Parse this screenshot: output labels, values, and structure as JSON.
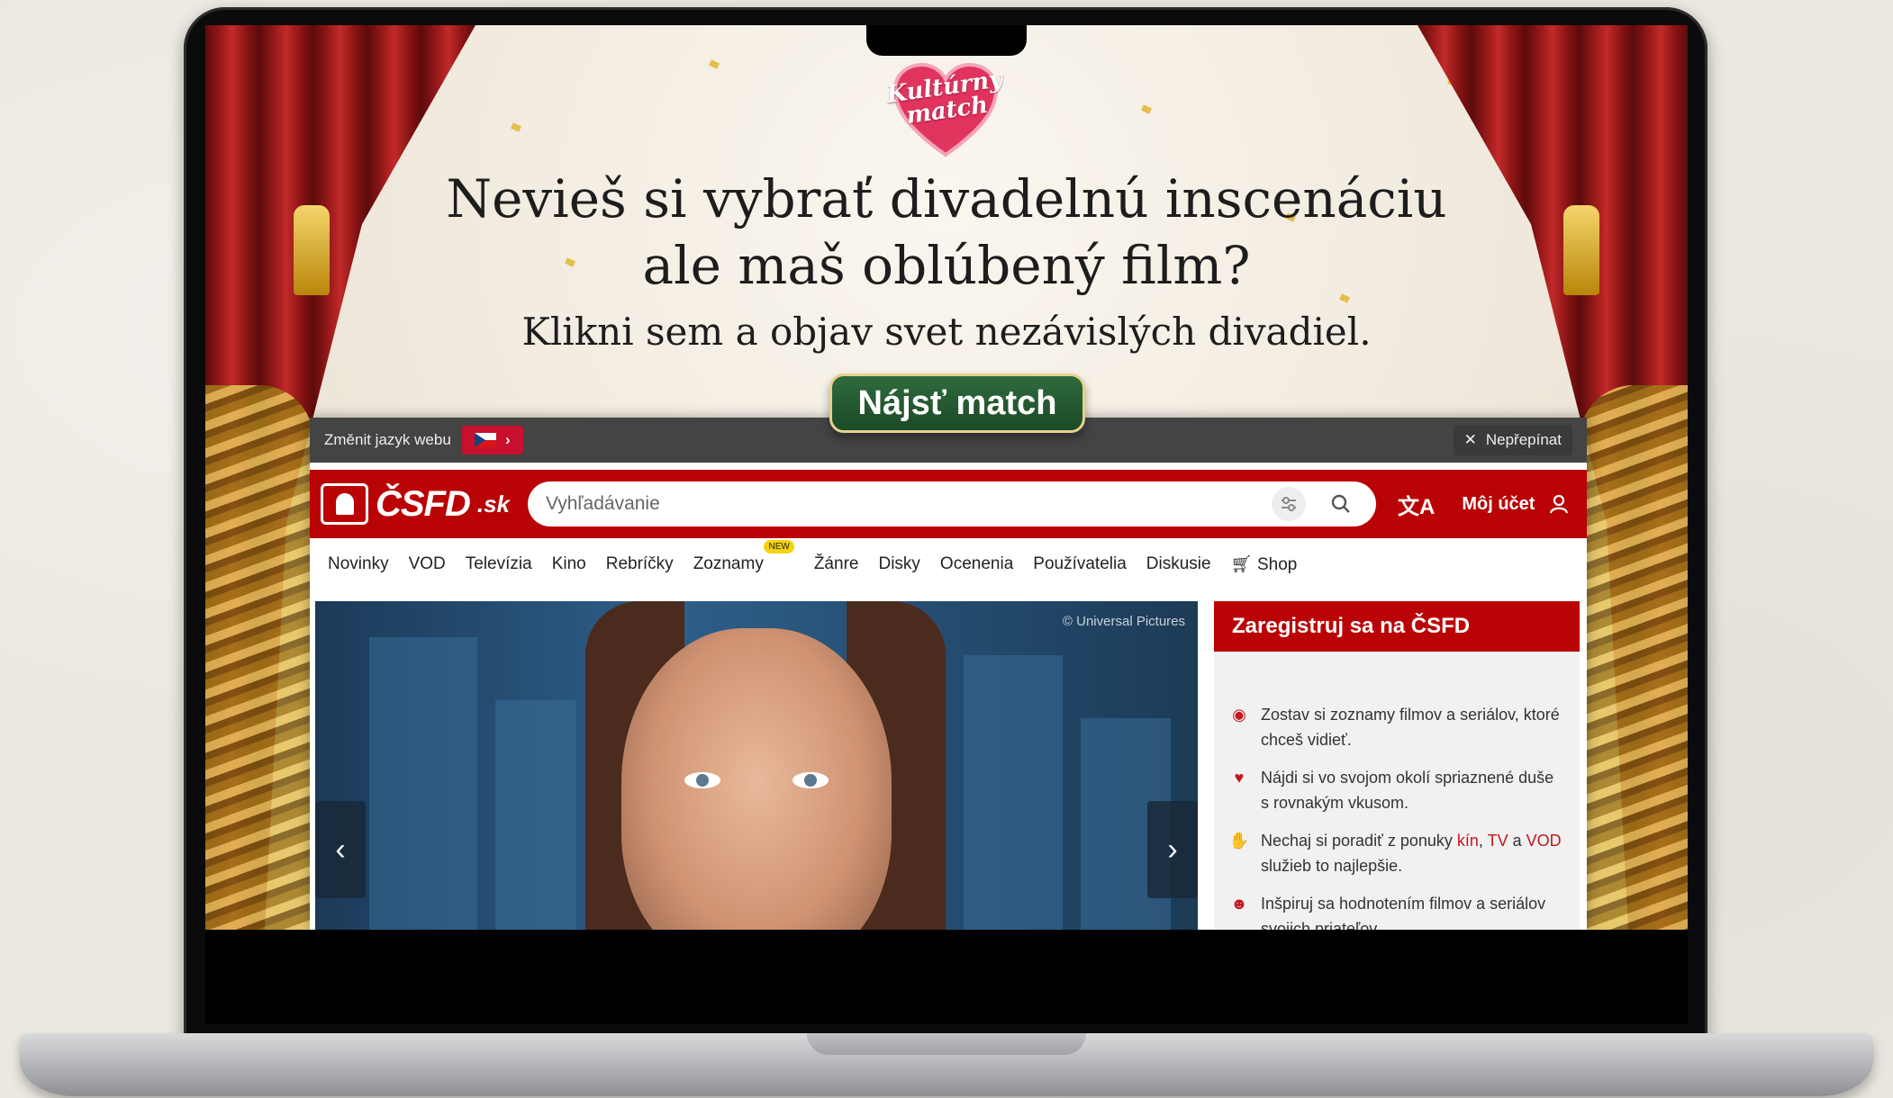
{
  "ad": {
    "logo_text": "Kultúrny match",
    "headline_line1": "Nevieš si vybrať divadelnú inscenáciu",
    "headline_line2": "ale maš oblúbený film?",
    "subline": "Klikni sem a objav svet nezávislých divadiel.",
    "cta": "Nájsť match"
  },
  "lang_bar": {
    "label": "Změnit jazyk webu",
    "close_label": "Nepřepínat"
  },
  "header": {
    "brand": "ČSFD",
    "brand_tld": ".sk",
    "search_placeholder": "Vyhľadávanie",
    "account": "Môj účet"
  },
  "nav": {
    "items": [
      "Novinky",
      "VOD",
      "Televízia",
      "Kino",
      "Rebríčky",
      "Zoznamy",
      "Žánre",
      "Disky",
      "Ocenenia",
      "Používatelia",
      "Diskusie",
      "Shop"
    ],
    "badge": "NEW"
  },
  "hero": {
    "copyright": "© Universal Pictures"
  },
  "register": {
    "title": "Zaregistruj sa na ČSFD",
    "item1": "Zostav si zoznamy filmov a seriálov, ktoré chceš vidieť.",
    "item2": "Nájdi si vo svojom okolí spriaznené duše s rovnakým vkusom.",
    "item3_pre": "Nechaj si poradiť z ponuky ",
    "item3_link1": "kín",
    "item3_sep": ", ",
    "item3_link2": "TV",
    "item3_mid": " a ",
    "item3_link3": "VOD",
    "item3_post": " služieb to najlepšie.",
    "item4": "Inšpiruj sa hodnotením filmov a seriálov svojich priateľov."
  },
  "colors": {
    "brand_red": "#ba0305",
    "cta_green": "#1b4a27",
    "badge_yellow": "#f5d20c"
  }
}
